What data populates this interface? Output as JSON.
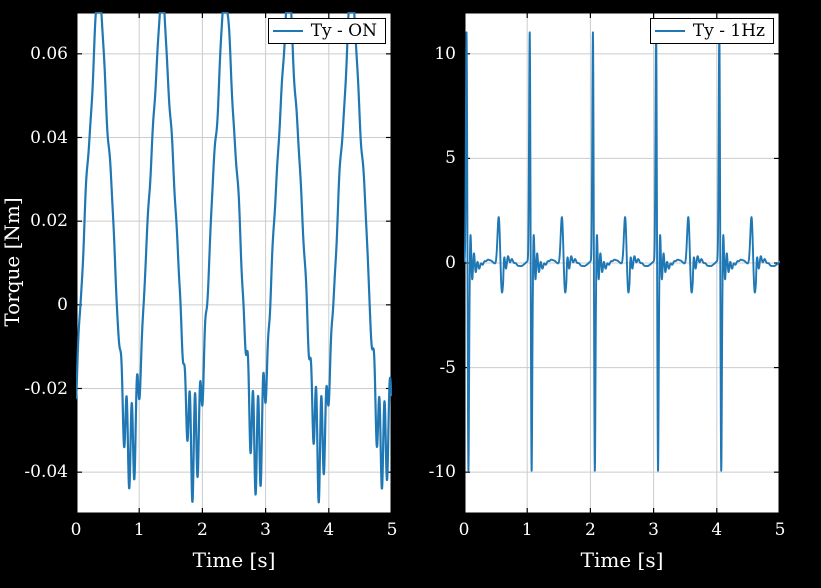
{
  "colors": {
    "line": "#1f77b4",
    "axis": "#000000",
    "grid": "#cccccc",
    "text_out": "#ffffff"
  },
  "left": {
    "legend": "Ty - ON",
    "xlabel": "Time [s]",
    "ylabel": "Torque [Nm]",
    "x_ticks": [
      0,
      1,
      2,
      3,
      4,
      5
    ],
    "y_ticks": [
      -0.04,
      -0.02,
      0,
      0.02,
      0.04,
      0.06
    ],
    "y_tick_labels": [
      "-0.04",
      "-0.02",
      "0",
      "0.02",
      "0.04",
      "0.06"
    ],
    "xlim": [
      0,
      5
    ],
    "ylim": [
      -0.05,
      0.07
    ]
  },
  "right": {
    "legend": "Ty - 1Hz",
    "xlabel": "Time [s]",
    "x_ticks": [
      0,
      1,
      2,
      3,
      4,
      5
    ],
    "y_ticks": [
      -10,
      -5,
      0,
      5,
      10
    ],
    "y_tick_labels": [
      "-10",
      "-5",
      "0",
      "5",
      "10"
    ],
    "xlim": [
      0,
      5
    ],
    "ylim": [
      -12,
      12
    ]
  },
  "chart_data": [
    {
      "type": "line",
      "title": "",
      "xlabel": "Time [s]",
      "ylabel": "Torque [Nm]",
      "xlim": [
        0,
        5
      ],
      "ylim": [
        -0.05,
        0.07
      ],
      "series_name": "Ty - ON",
      "description": "Approximately sinusoidal torque signal, 5 cycles over 5 s (~1 Hz), peaks near 0.065 Nm, troughs near -0.04 Nm, slight double-peak distortion at crests and small ripple near troughs."
    },
    {
      "type": "line",
      "title": "",
      "xlabel": "Time [s]",
      "ylabel": "",
      "xlim": [
        0,
        5
      ],
      "ylim": [
        -12,
        12
      ],
      "series_name": "Ty - 1Hz",
      "description": "Impulsive torque waveform at 1 Hz. Near each integer second a sharp positive spike to ~11 immediately followed by a sharp negative spike to ~ -10, then a brief damped ringing settling near 0. A second smaller positive excursion (~2) occurs roughly mid-cycle."
    }
  ]
}
